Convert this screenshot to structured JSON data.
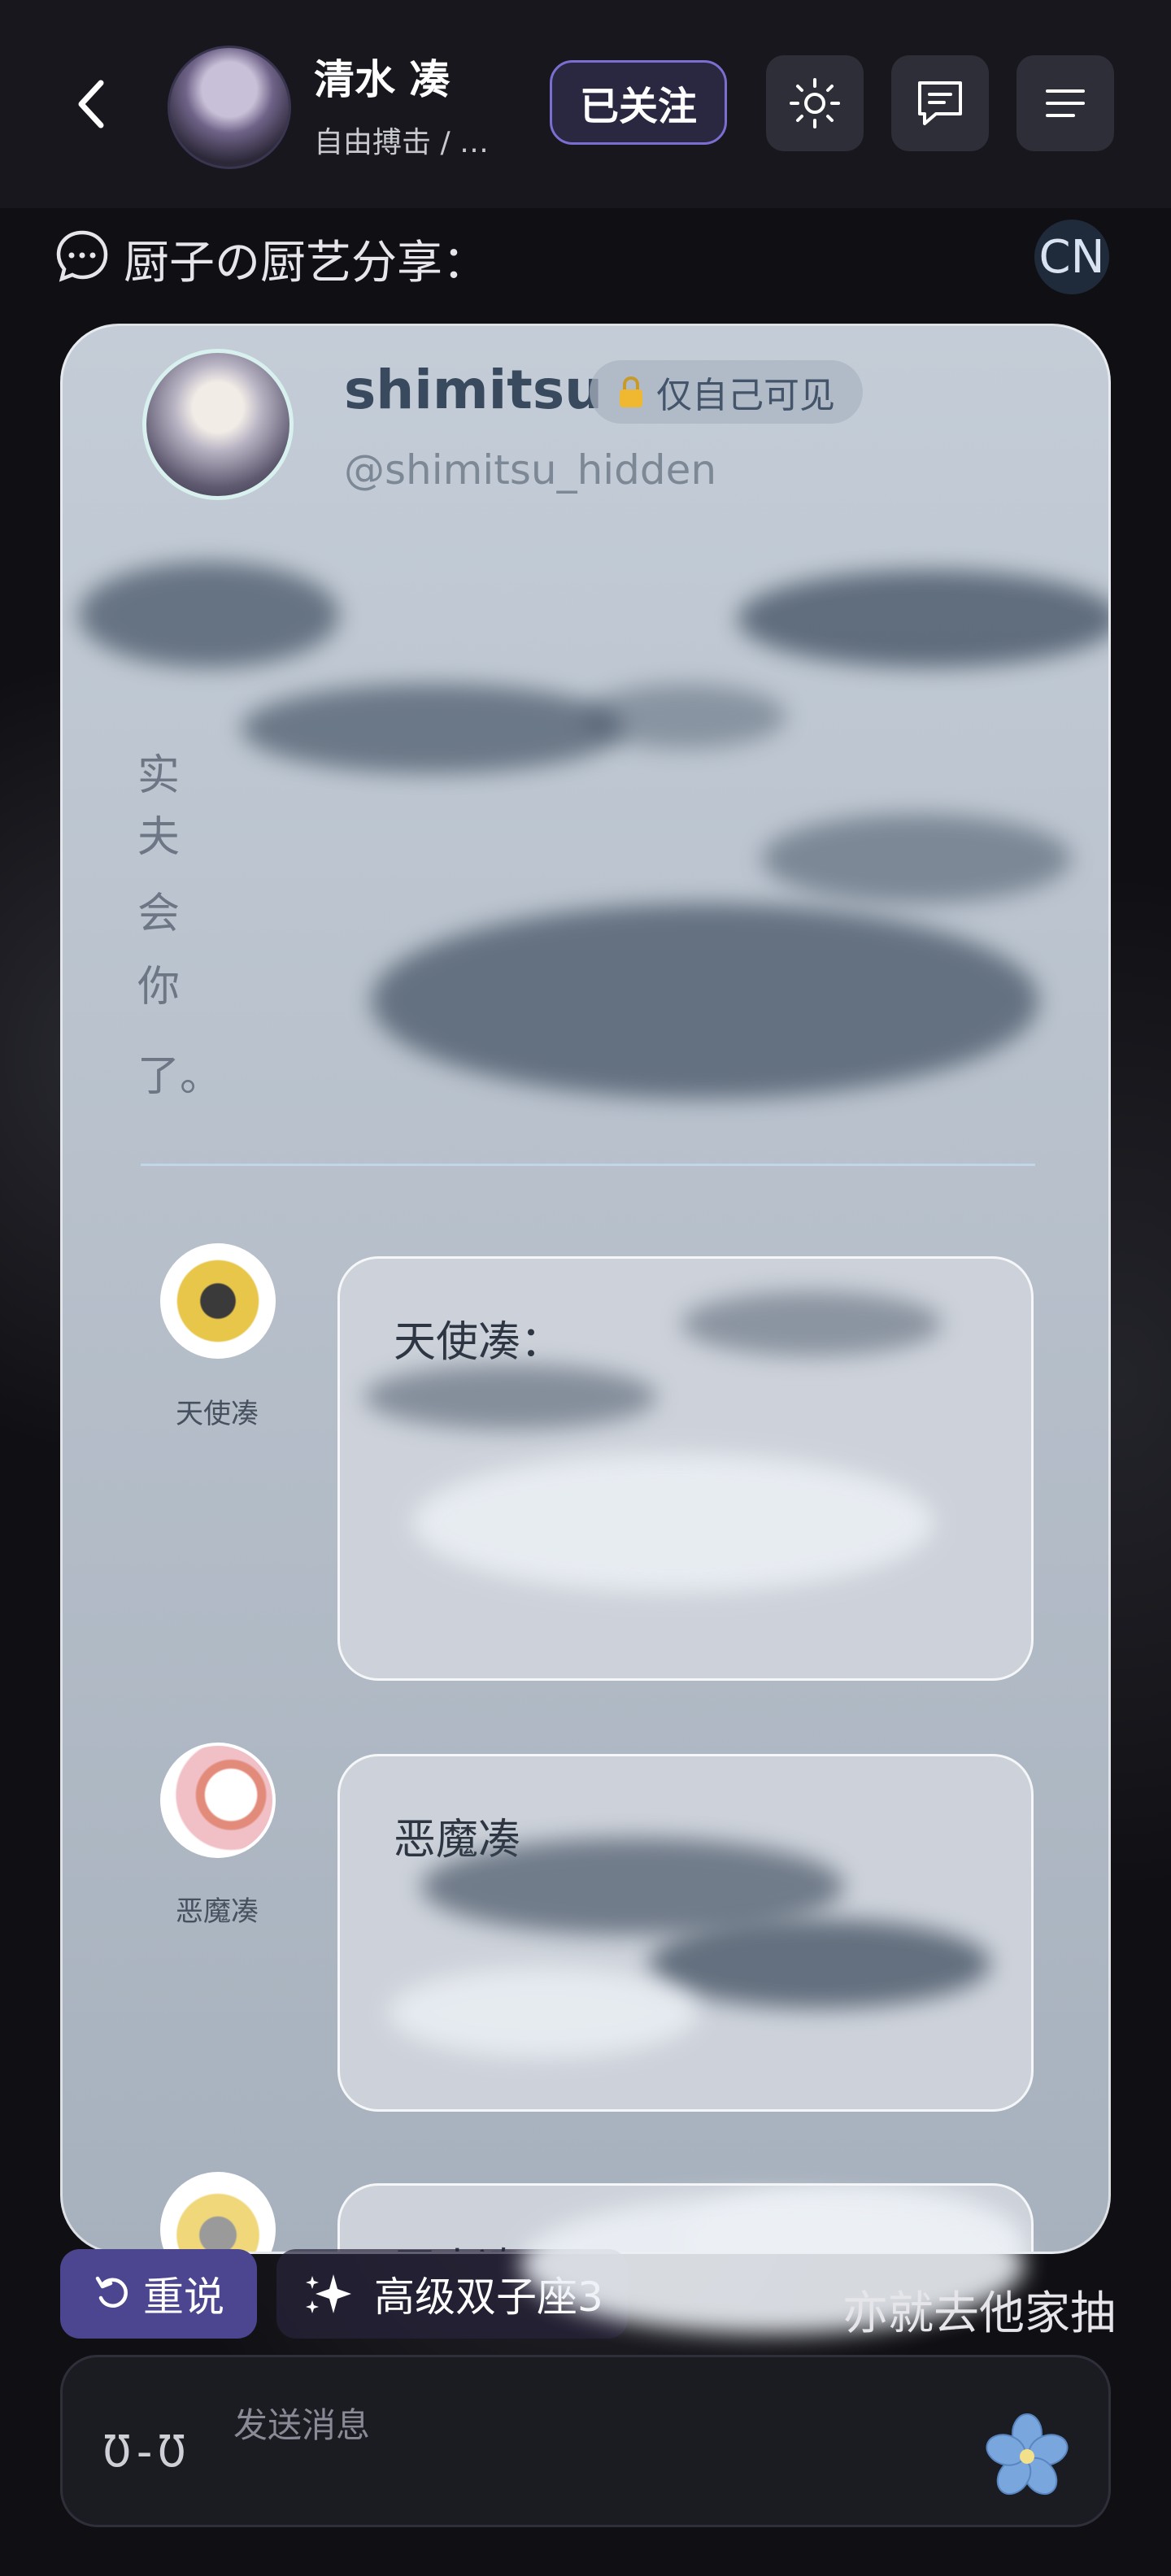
{
  "header": {
    "name": "清水 凑",
    "subtitle": "自由搏击 / …",
    "follow_label": "已关注"
  },
  "topic": {
    "title": "厨子の厨艺分享：",
    "lang_badge": "CN"
  },
  "card": {
    "name": "shimitsu",
    "privacy_label": "仅自己可见",
    "handle": "@shimitsu_hidden",
    "body_fragments": [
      "实",
      "夫",
      "会",
      "你",
      "了。"
    ],
    "replies": [
      {
        "author": "天使凑",
        "text_prefix": "天使凑："
      },
      {
        "author": "恶魔凑",
        "text_prefix": "恶魔凑"
      },
      {
        "author": "",
        "text_prefix": "王小凑："
      }
    ]
  },
  "bottom": {
    "redo_label": "重说",
    "suggestion_label": "高级双子座3",
    "tail_text": "亦就去他家抽",
    "input_placeholder": "发送消息",
    "face_glyph": "Ʊ-Ʊ"
  },
  "colors": {
    "accent": "#4c4590",
    "follow_border": "#7a6fd0",
    "card_bg": "#c4cdd7"
  }
}
